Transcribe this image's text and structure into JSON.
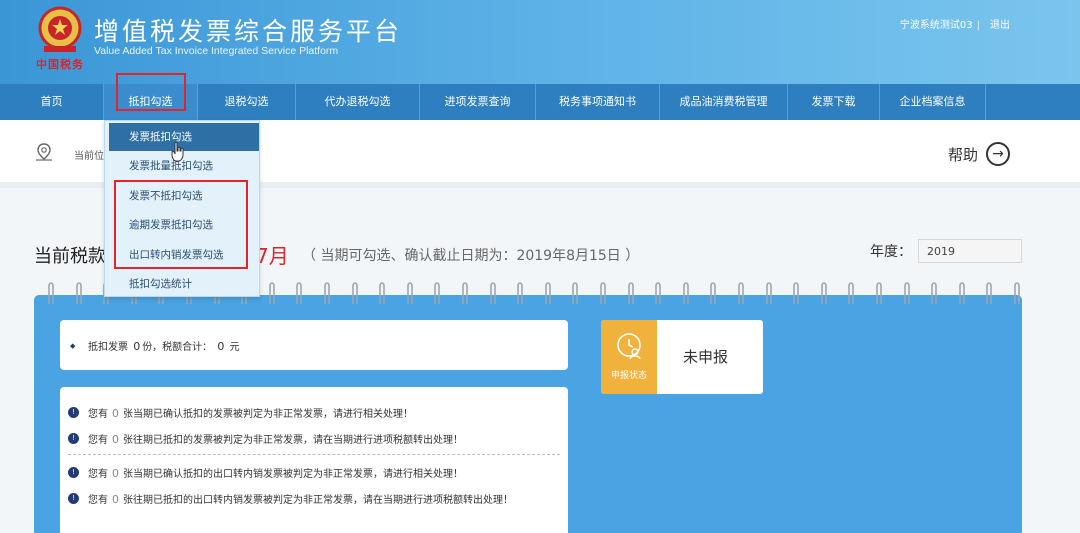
{
  "header": {
    "title_cn": "增值税发票综合服务平台",
    "title_en": "Value Added Tax Invoice Integrated Service Platform",
    "brand_cn": "中国税务",
    "user": "宁波系统测试03",
    "logout": "退出",
    "emblem_icon": "tax-emblem-icon"
  },
  "nav": {
    "items": [
      {
        "label": "首页"
      },
      {
        "label": "抵扣勾选"
      },
      {
        "label": "退税勾选"
      },
      {
        "label": "代办退税勾选"
      },
      {
        "label": "进项发票查询"
      },
      {
        "label": "税务事项通知书"
      },
      {
        "label": "成品油消费税管理"
      },
      {
        "label": "发票下载"
      },
      {
        "label": "企业档案信息"
      }
    ]
  },
  "dropdown": {
    "items": [
      {
        "label": "发票抵扣勾选"
      },
      {
        "label": "发票批量抵扣勾选"
      },
      {
        "label": "发票不抵扣勾选"
      },
      {
        "label": "逾期发票抵扣勾选"
      },
      {
        "label": "出口转内销发票勾选"
      },
      {
        "label": "抵扣勾选统计"
      }
    ]
  },
  "breadcrumb": {
    "prefix": "当前位"
  },
  "help": {
    "label": "帮助",
    "icon": "arrow-right-circle-icon"
  },
  "period": {
    "title": "当前税款",
    "month": "7月",
    "note": "（ 当期可勾选、确认截止日期为：2019年8月15日 ）",
    "year_label": "年度：",
    "year_value": "2019"
  },
  "summary": {
    "prefix": "抵扣发票",
    "count": "0",
    "mid": "份，税额合计：",
    "amount": "0",
    "suffix": "元"
  },
  "notices": [
    {
      "pre": "您有",
      "num": "0",
      "text": "张当期已确认抵扣的发票被判定为非正常发票，请进行相关处理！"
    },
    {
      "pre": "您有",
      "num": "0",
      "text": "张往期已抵扣的发票被判定为非正常发票，请在当期进行进项税额转出处理！"
    },
    {
      "pre": "您有",
      "num": "0",
      "text": "张当期已确认抵扣的出口转内销发票被判定为非正常发票，请进行相关处理！"
    },
    {
      "pre": "您有",
      "num": "0",
      "text": "张往期已抵扣的出口转内销发票被判定为非正常发票，请在当期进行进项税额转出处理！"
    }
  ],
  "status": {
    "label": "申报状态",
    "value": "未申报"
  },
  "colors": {
    "accent": "#2e7fbf",
    "highlight": "#e0252b",
    "status": "#f0b23c",
    "panel": "#4aa3e2"
  }
}
